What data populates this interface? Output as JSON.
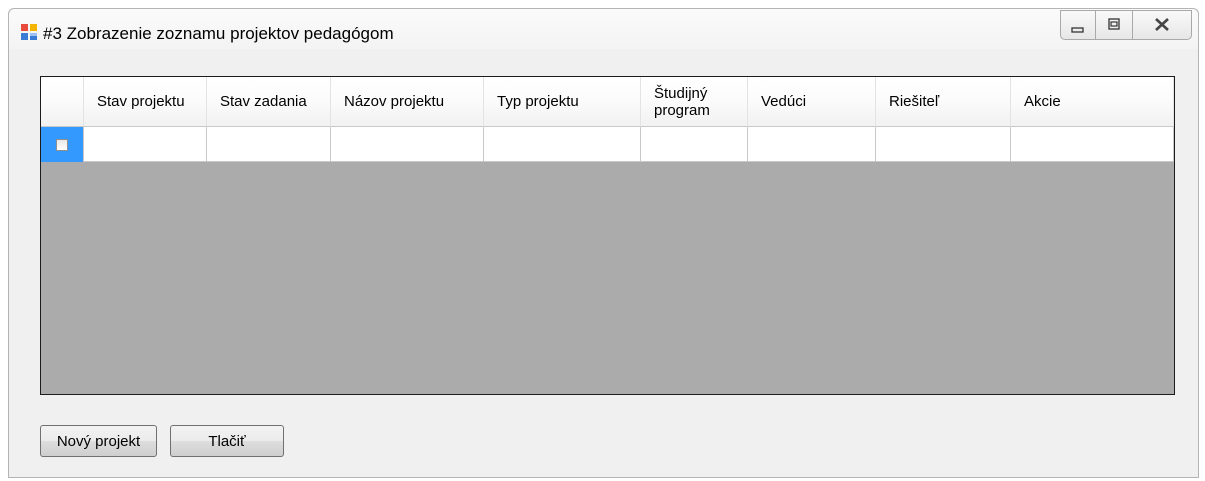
{
  "window": {
    "title": "#3 Zobrazenie zoznamu projektov pedagógom",
    "icon": "winforms-app-icon",
    "controls": [
      "minimize-icon",
      "maximize-icon",
      "close-icon"
    ]
  },
  "grid": {
    "columns": [
      "",
      "Stav projektu",
      "Stav zadania",
      "Názov projektu",
      "Typ projektu",
      "Študijný program",
      "Vedúci",
      "Riešiteľ",
      "Akcie"
    ],
    "rows": [
      {
        "checked": false,
        "cells": [
          "",
          "",
          "",
          "",
          "",
          "",
          "",
          ""
        ]
      }
    ],
    "empty_area_color": "#ababab",
    "selected_row_header_color": "#3399ff"
  },
  "buttons": {
    "new_project": "Nový projekt",
    "print": "Tlačiť"
  }
}
